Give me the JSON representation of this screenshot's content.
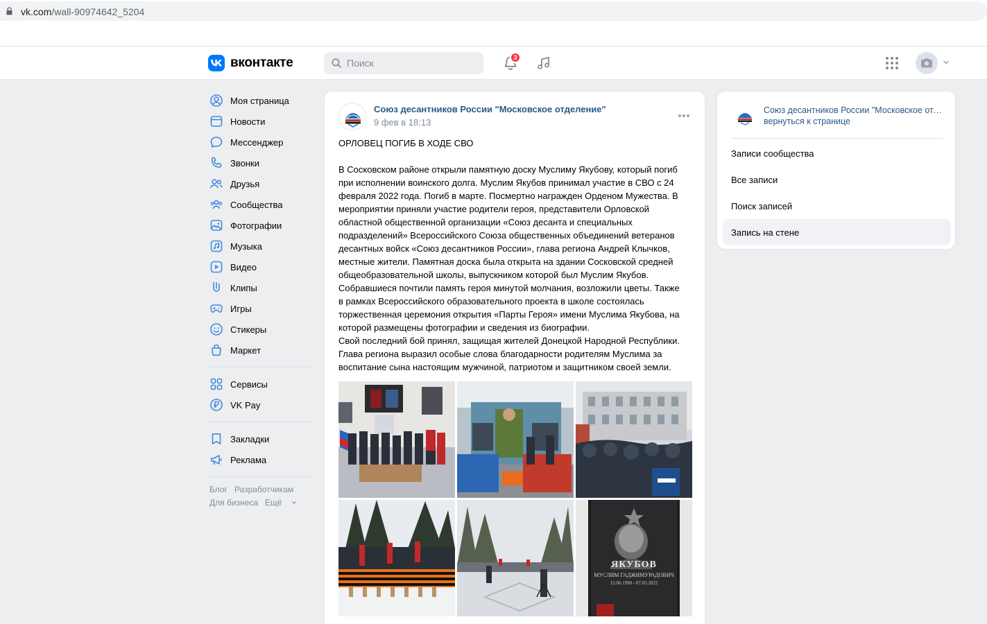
{
  "browser": {
    "url_domain": "vk.com",
    "url_path": "/wall-90974642_5204"
  },
  "header": {
    "logo_text": "вконтакте",
    "search_placeholder": "Поиск",
    "notifications_count": "3"
  },
  "left_nav": {
    "items": [
      {
        "label": "Моя страница",
        "icon": "user-circle-icon"
      },
      {
        "label": "Новости",
        "icon": "news-icon"
      },
      {
        "label": "Мессенджер",
        "icon": "message-icon"
      },
      {
        "label": "Звонки",
        "icon": "phone-icon"
      },
      {
        "label": "Друзья",
        "icon": "friends-icon"
      },
      {
        "label": "Сообщества",
        "icon": "communities-icon"
      },
      {
        "label": "Фотографии",
        "icon": "photo-icon"
      },
      {
        "label": "Музыка",
        "icon": "music-icon"
      },
      {
        "label": "Видео",
        "icon": "video-icon"
      },
      {
        "label": "Клипы",
        "icon": "clips-icon"
      },
      {
        "label": "Игры",
        "icon": "gamepad-icon"
      },
      {
        "label": "Стикеры",
        "icon": "smile-icon"
      },
      {
        "label": "Маркет",
        "icon": "bag-icon"
      }
    ],
    "items2": [
      {
        "label": "Сервисы",
        "icon": "services-icon"
      },
      {
        "label": "VK Pay",
        "icon": "vkpay-icon"
      }
    ],
    "items3": [
      {
        "label": "Закладки",
        "icon": "bookmark-icon"
      },
      {
        "label": "Реклама",
        "icon": "megaphone-icon"
      }
    ],
    "footer": {
      "blog": "Блог",
      "developers": "Разработчикам",
      "business": "Для бизнеса",
      "more": "Ещё"
    }
  },
  "post": {
    "author": "Союз десантников России \"Московское отделение\"",
    "date": "9 фев в 18:13",
    "title": "ОРЛОВЕЦ ПОГИБ В ХОДЕ СВО",
    "body": "В Сосковском районе открыли памятную доску Муслиму Якубову, который погиб\nпри исполнении воинского долга. Муслим Якубов принимал участие в СВО с 24\nфевраля 2022 года. Погиб в марте. Посмертно награжден Орденом Мужества. В\nмероприятии приняли участие родители героя, представители Орловской\nобластной общественной организации «Союз десанта и специальных\nподразделений» Всероссийского Союза общественных объединений ветеранов\nдесантных войск «Союз десантников России», глава региона Андрей Клычков,\nместные жители. Памятная доска была открыта на здании Сосковской средней\nобщеобразовательной школы, выпускником которой был Муслим Якубов.\nСобравшиеся почтили память героя минутой молчания, возложили цветы.  Также\nв рамках Всероссийского образовательного проекта в школе состоялась\nторжественная церемония открытия «Парты Героя» имени Муслима Якубова, на\nкоторой размещены фотографии и сведения из биографии.\nСвой последний бой принял, защищая жителей Донецкой Народной Республики.\nГлава региона выразил особые слова благодарности родителям Муслима за\nвоспитание сына настоящим мужчиной, патриотом и защитником своей земли.",
    "plaque": {
      "surname": "ЯКУБОВ",
      "name": "МУСЛИМ ГАДЖИМУРАДОВИЧ",
      "dates": "15.06.1990 - 07.03.2022"
    }
  },
  "right_panel": {
    "community_name": "Союз десантников России \"Московское отделение\"",
    "back_link": "вернуться к странице",
    "menu": [
      {
        "label": "Записи сообщества"
      },
      {
        "label": "Все записи"
      },
      {
        "label": "Поиск записей"
      },
      {
        "label": "Запись на стене"
      }
    ]
  },
  "colors": {
    "vk_blue": "#0077ff",
    "link": "#2a5885",
    "background": "#edeef0",
    "badge_red": "#ff3347"
  }
}
